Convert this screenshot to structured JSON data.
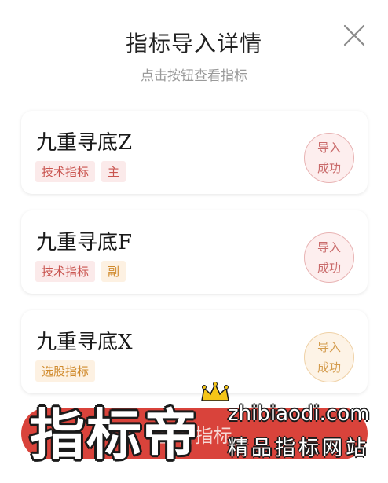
{
  "dialog": {
    "title": "指标导入详情",
    "subtitle": "点击按钮查看指标"
  },
  "cards": [
    {
      "name": "九重寻底Z",
      "tags": [
        "技术指标",
        "主"
      ],
      "status": [
        "导入",
        "成功"
      ]
    },
    {
      "name": "九重寻底F",
      "tags": [
        "技术指标",
        "副"
      ],
      "status": [
        "导入",
        "成功"
      ]
    },
    {
      "name": "九重寻底X",
      "tags": [
        "选股指标"
      ],
      "status": [
        "导入",
        "成功"
      ]
    }
  ],
  "bottom_button": {
    "label": "查看指标"
  },
  "watermark": {
    "brand": "指标帝",
    "url": "zhibiaodi.com",
    "slogan": "精品指标网站"
  },
  "colors": {
    "accent_red": "#d9433b",
    "tag_red": "#c9544f",
    "tag_orange": "#d08a2c"
  },
  "icons": {
    "close": "close-icon",
    "crown": "crown-icon"
  }
}
